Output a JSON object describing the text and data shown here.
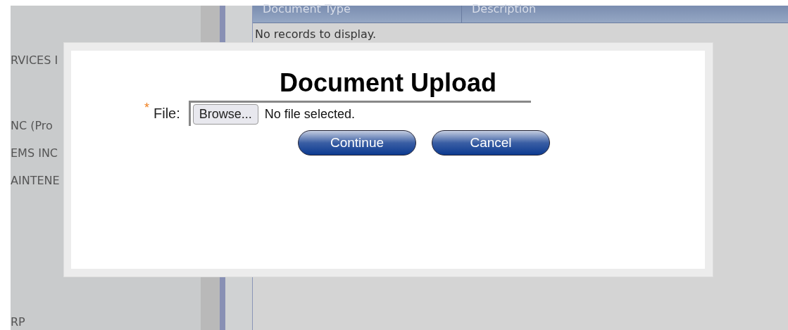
{
  "sidebar": {
    "items": [
      "RVICES I",
      "NC (Pro",
      "EMS INC",
      "AINTENE",
      "RP"
    ]
  },
  "table": {
    "columns": [
      "Document Type",
      "Description"
    ],
    "empty_message": "No records to display."
  },
  "dialog": {
    "title": "Document Upload",
    "field": {
      "required_mark": "*",
      "label": "File:",
      "button": "Browse...",
      "value": "No file selected."
    },
    "buttons": [
      "Continue",
      "Cancel"
    ]
  }
}
